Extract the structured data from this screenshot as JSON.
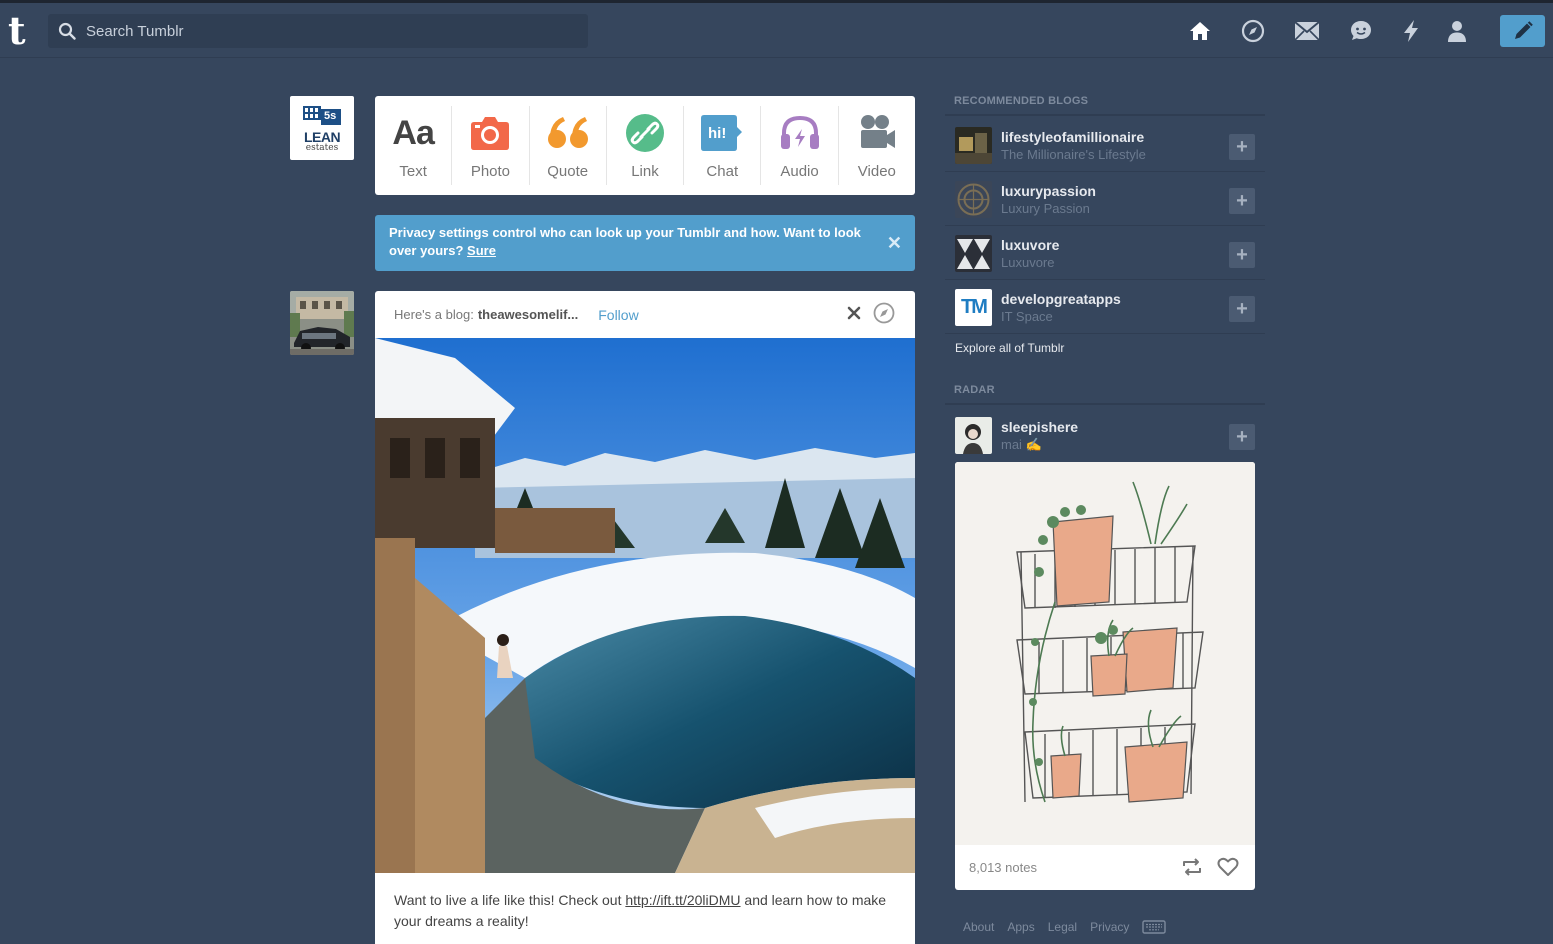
{
  "topbar": {
    "logo": "t",
    "search_placeholder": "Search Tumblr",
    "nav_icons": [
      "home-icon",
      "compass-icon",
      "mail-icon",
      "chat-bubble-icon",
      "lightning-icon",
      "person-icon"
    ],
    "compose_icon": "pencil-icon"
  },
  "lean_avatar": {
    "badge": "5s",
    "line1": "LEAN",
    "line2": "estates"
  },
  "post_types": [
    {
      "label": "Text",
      "icon": "text-icon",
      "color": "#444444"
    },
    {
      "label": "Photo",
      "icon": "camera-icon",
      "color": "#f26849"
    },
    {
      "label": "Quote",
      "icon": "quote-icon",
      "color": "#f2992e"
    },
    {
      "label": "Link",
      "icon": "link-icon",
      "color": "#56bc8a"
    },
    {
      "label": "Chat",
      "icon": "chat-icon",
      "color": "#529ecc"
    },
    {
      "label": "Audio",
      "icon": "headphones-icon",
      "color": "#a77dc2"
    },
    {
      "label": "Video",
      "icon": "video-camera-icon",
      "color": "#748089"
    }
  ],
  "privacy": {
    "text": "Privacy settings control who can look up your Tumblr and how. Want to look over yours?",
    "link": "Sure",
    "close": "✕"
  },
  "post": {
    "intro": "Here's a blog:",
    "blog_name": "theawesomelif...",
    "follow": "Follow",
    "body_before": "Want to live a life like this! Check out",
    "link": "http://ift.tt/20liDMU",
    "body_after": "and learn how to make your dreams a reality!"
  },
  "sidebar": {
    "recommended_title": "RECOMMENDED BLOGS",
    "blogs": [
      {
        "name": "lifestyleofamillionaire",
        "subtitle": "The Millionaire's Lifestyle"
      },
      {
        "name": "luxurypassion",
        "subtitle": "Luxury Passion"
      },
      {
        "name": "luxuvore",
        "subtitle": "Luxuvore"
      },
      {
        "name": "developgreatapps",
        "subtitle": "IT Space",
        "avatar_text": "TM"
      }
    ],
    "plus": "+",
    "explore": "Explore all of Tumblr",
    "radar_title": "RADAR",
    "radar": {
      "name": "sleepishere",
      "subtitle": "mai ✍",
      "notes": "8,013 notes"
    }
  },
  "footer": [
    "About",
    "Apps",
    "Legal",
    "Privacy"
  ]
}
